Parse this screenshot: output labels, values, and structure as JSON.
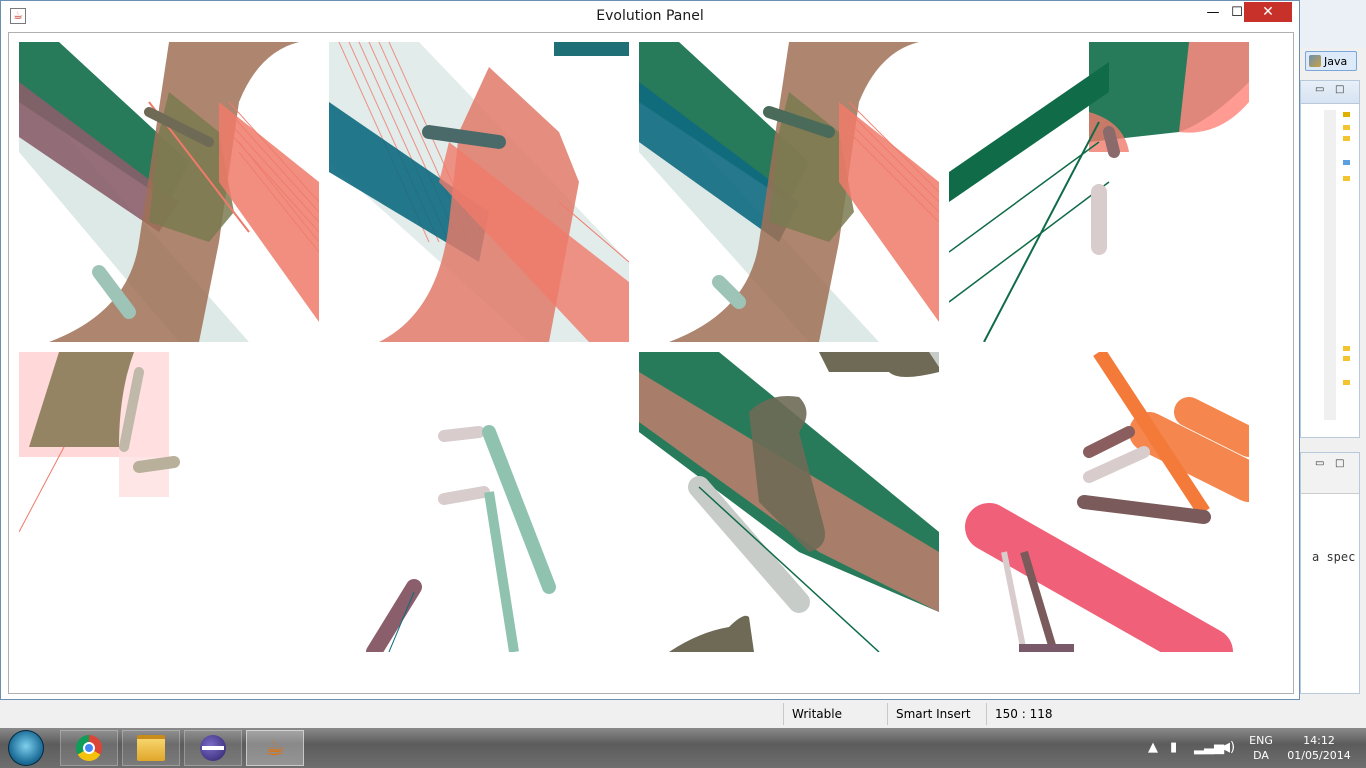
{
  "window": {
    "title": "Evolution Panel",
    "icon": "java-cup-icon",
    "minimize_glyph": "—",
    "maximize_glyph": "☐",
    "close_glyph": "✕"
  },
  "background_app": {
    "perspective_label": "Java",
    "console_text": "a spec"
  },
  "statusbar": {
    "mode": "Writable",
    "insert": "Smart Insert",
    "position": "150 : 118"
  },
  "taskbar": {
    "apps": [
      "chrome-icon",
      "file-explorer-icon",
      "eclipse-icon",
      "java-icon"
    ],
    "language_top": "ENG",
    "language_bottom": "DA",
    "time": "14:12",
    "date": "01/05/2014"
  },
  "panel": {
    "tiles": [
      {
        "name": "evolution-tile-1"
      },
      {
        "name": "evolution-tile-2"
      },
      {
        "name": "evolution-tile-3"
      },
      {
        "name": "evolution-tile-4"
      },
      {
        "name": "evolution-tile-5"
      },
      {
        "name": "evolution-tile-6"
      },
      {
        "name": "evolution-tile-7"
      },
      {
        "name": "evolution-tile-8"
      }
    ]
  },
  "colors": {
    "green": "#0f6b48",
    "teal": "#0e6a80",
    "salmon": "#f07a6a",
    "mauve": "#8a5e6a",
    "olive": "#6e6a55",
    "mint": "#8fc3b0",
    "orange": "#f47a3a",
    "pink": "#f06078",
    "close_red": "#c7312a"
  }
}
